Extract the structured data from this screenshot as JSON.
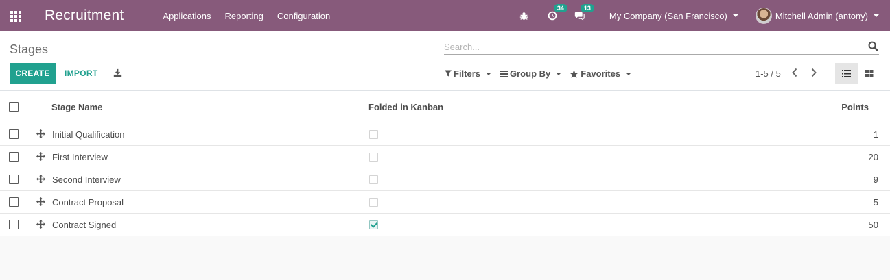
{
  "navbar": {
    "brand": "Recruitment",
    "menu": [
      "Applications",
      "Reporting",
      "Configuration"
    ],
    "activity_count": "34",
    "message_count": "13",
    "company": "My Company (San Francisco)",
    "user": "Mitchell Admin (antony)",
    "bg_color": "#875a7b"
  },
  "control_panel": {
    "breadcrumb": "Stages",
    "search_placeholder": "Search...",
    "create_label": "CREATE",
    "import_label": "IMPORT",
    "filters_label": "Filters",
    "groupby_label": "Group By",
    "favorites_label": "Favorites",
    "pager": "1-5 / 5",
    "accent_color": "#21a18f"
  },
  "table": {
    "headers": {
      "name": "Stage Name",
      "fold": "Folded in Kanban",
      "points": "Points"
    },
    "rows": [
      {
        "name": "Initial Qualification",
        "folded": false,
        "points": "1"
      },
      {
        "name": "First Interview",
        "folded": false,
        "points": "20"
      },
      {
        "name": "Second Interview",
        "folded": false,
        "points": "9"
      },
      {
        "name": "Contract Proposal",
        "folded": false,
        "points": "5"
      },
      {
        "name": "Contract Signed",
        "folded": true,
        "points": "50"
      }
    ]
  }
}
